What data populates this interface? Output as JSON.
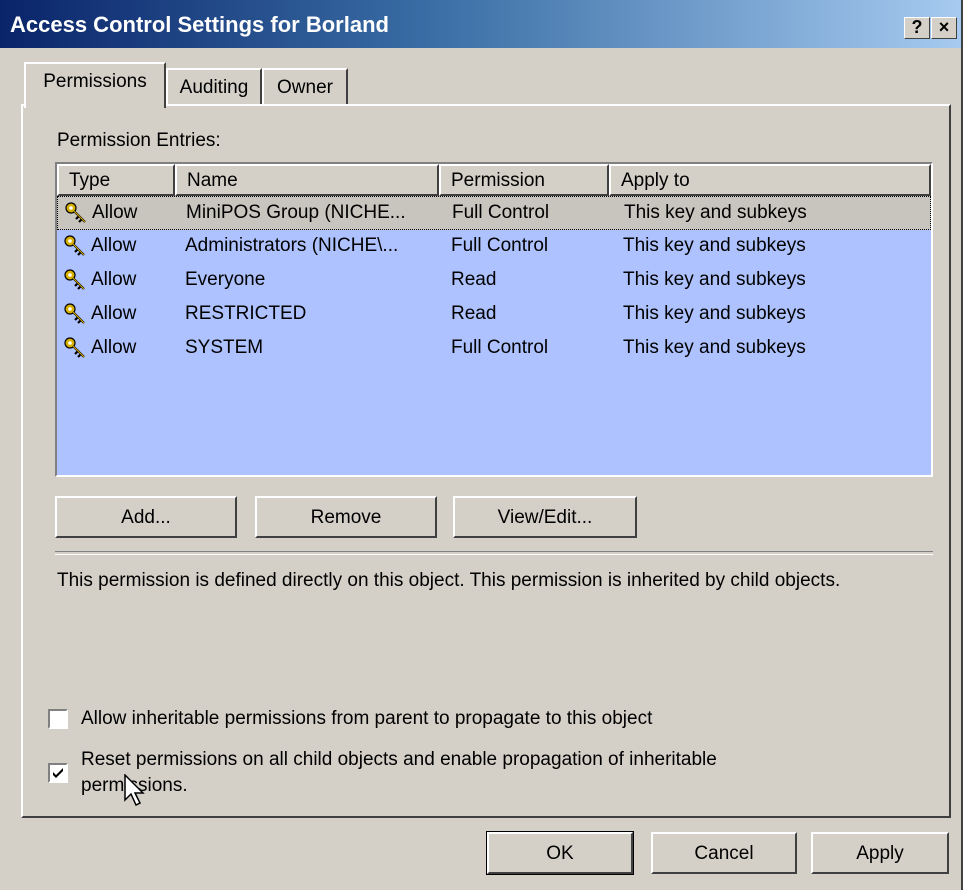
{
  "window": {
    "title": "Access Control Settings for Borland",
    "help_label": "?",
    "close_label": "×"
  },
  "tabs": [
    {
      "label": "Permissions",
      "active": true
    },
    {
      "label": "Auditing",
      "active": false
    },
    {
      "label": "Owner",
      "active": false
    }
  ],
  "permissions": {
    "section_label": "Permission Entries:",
    "columns": [
      "Type",
      "Name",
      "Permission",
      "Apply to"
    ],
    "entries": [
      {
        "type": "Allow",
        "name": "MiniPOS Group (NICHE...",
        "permission": "Full Control",
        "apply_to": "This key and subkeys"
      },
      {
        "type": "Allow",
        "name": "Administrators (NICHE\\...",
        "permission": "Full Control",
        "apply_to": "This key and subkeys"
      },
      {
        "type": "Allow",
        "name": "Everyone",
        "permission": "Read",
        "apply_to": "This key and subkeys"
      },
      {
        "type": "Allow",
        "name": "RESTRICTED",
        "permission": "Read",
        "apply_to": "This key and subkeys"
      },
      {
        "type": "Allow",
        "name": "SYSTEM",
        "permission": "Full Control",
        "apply_to": "This key and subkeys"
      }
    ],
    "row_icon": "key-icon",
    "add_label": "Add...",
    "remove_label": "Remove",
    "view_edit_label": "View/Edit...",
    "description": "This permission is defined directly on this object. This permission is inherited by child objects.",
    "inherit_checkbox": {
      "label": "Allow inheritable permissions from parent to propagate to this object",
      "checked": false
    },
    "reset_checkbox": {
      "line1": "Reset permissions on all child objects and enable propagation of inheritable",
      "line2": "permissions.",
      "checked": true
    }
  },
  "footer": {
    "ok_label": "OK",
    "cancel_label": "Cancel",
    "apply_label": "Apply"
  },
  "colors": {
    "title_start": "#0a246a",
    "title_end": "#a6caf0",
    "selection": "#adc2ff",
    "face": "#d4d0c8"
  }
}
